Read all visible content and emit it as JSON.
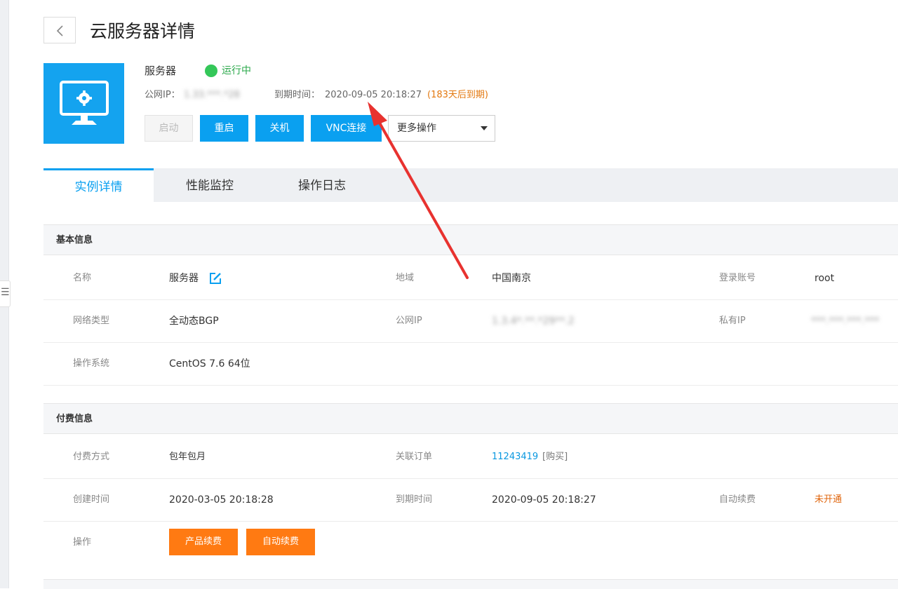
{
  "page": {
    "title": "云服务器详情"
  },
  "server": {
    "name": "服务器",
    "status": "运行中",
    "public_ip_label": "公网IP：",
    "public_ip_value": "1.33.***.*28",
    "expire_label": "到期时间：",
    "expire_value": "2020-09-05 20:18:27",
    "expire_remaining": "(183天后到期)"
  },
  "actions": {
    "start": "启动",
    "restart": "重启",
    "shutdown": "关机",
    "vnc": "VNC连接",
    "more": "更多操作"
  },
  "tabs": [
    {
      "label": "实例详情",
      "active": true
    },
    {
      "label": "性能监控",
      "active": false
    },
    {
      "label": "操作日志",
      "active": false
    }
  ],
  "basic_info": {
    "title": "基本信息",
    "name_label": "名称",
    "name_value": "服务器",
    "region_label": "地域",
    "region_value": "中国南京",
    "account_label": "登录账号",
    "account_value": "root",
    "network_label": "网络类型",
    "network_value": "全动态BGP",
    "public_ip_label": "公网IP",
    "public_ip_value": "1.3.4*.**.*29**.2",
    "private_ip_label": "私有IP",
    "private_ip_value": "***.***.***.***",
    "os_label": "操作系统",
    "os_value": "CentOS 7.6 64位"
  },
  "billing_info": {
    "title": "付费信息",
    "method_label": "付费方式",
    "method_value": "包年包月",
    "order_label": "关联订单",
    "order_value": "11243419",
    "order_purchase": "[购买]",
    "created_label": "创建时间",
    "created_value": "2020-03-05 20:18:28",
    "expire_label": "到期时间",
    "expire_value": "2020-09-05 20:18:27",
    "auto_renew_label": "自动续费",
    "auto_renew_value": "未开通",
    "ops_label": "操作",
    "renew_button": "产品续费",
    "auto_renew_button": "自动续费"
  },
  "colors": {
    "primary": "#0aa0f0",
    "running": "#34c759",
    "warning": "#e3780f",
    "orange_button": "#ff7a12",
    "annotation_arrow": "#e8322f"
  }
}
